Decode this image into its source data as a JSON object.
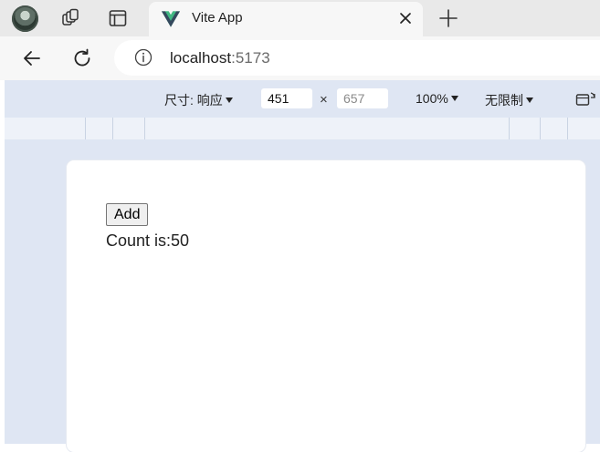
{
  "browser": {
    "tab": {
      "title": "Vite App"
    },
    "address": {
      "host": "localhost",
      "port": ":5173"
    }
  },
  "devtools": {
    "dimensions_label": "尺寸: 响应",
    "width_value": "451",
    "height_placeholder": "657",
    "times": "×",
    "zoom": "100%",
    "throttle": "无限制"
  },
  "page": {
    "button_label": "Add",
    "count_prefix": "Count is:",
    "count_value": "50"
  }
}
